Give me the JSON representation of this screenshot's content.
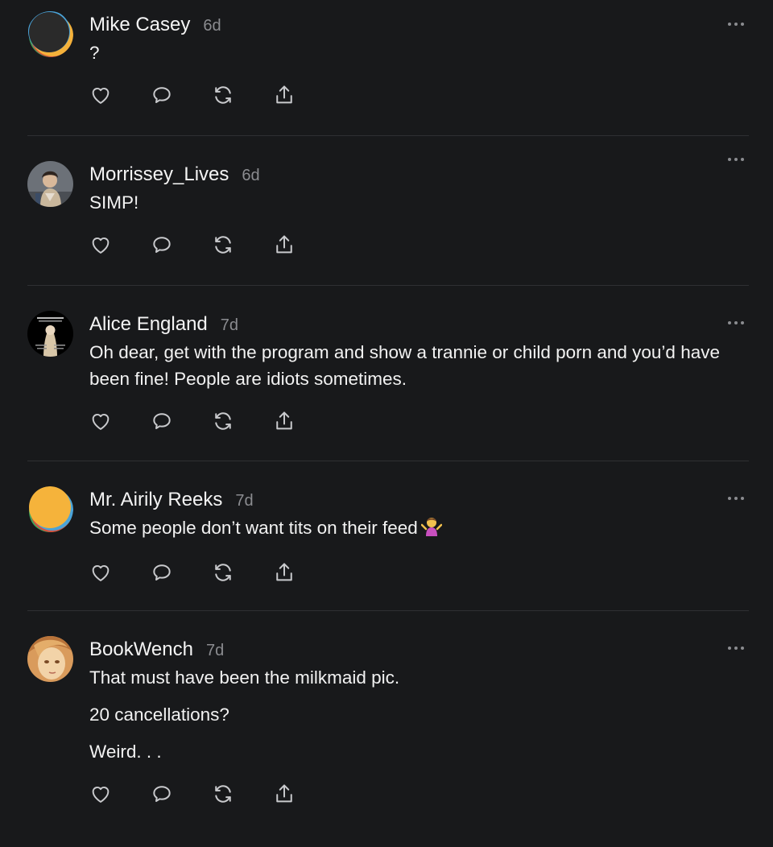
{
  "posts": [
    {
      "author": "Mike Casey",
      "time": "6d",
      "lines": [
        "?"
      ],
      "avatar": {
        "type": "default",
        "colors": [
          "#2b2b2b",
          "#4aa3d8",
          "#f4b13a",
          "#d94f3d",
          "#3fa55b"
        ]
      }
    },
    {
      "author": "Morrissey_Lives",
      "time": "6d",
      "lines": [
        "SIMP!"
      ],
      "avatar": {
        "type": "photo",
        "colors": [
          "#5a5f66",
          "#c9b79c",
          "#3b2f2a"
        ]
      }
    },
    {
      "author": "Alice England",
      "time": "7d",
      "lines": [
        "Oh dear, get with the program and show a trannie or child porn and you’d have been fine! People are idiots sometimes."
      ],
      "avatar": {
        "type": "photo",
        "colors": [
          "#000000",
          "#d8c6a8",
          "#8a7a6a"
        ]
      }
    },
    {
      "author": "Mr. Airily Reeks",
      "time": "7d",
      "lines": [
        "Some people don’t want tits on their feed"
      ],
      "emoji": "person-shrugging",
      "avatar": {
        "type": "default",
        "colors": [
          "#f5b33b",
          "#d94f3d",
          "#3fa55b",
          "#4aa3d8"
        ]
      }
    },
    {
      "author": "BookWench",
      "time": "7d",
      "lines": [
        "That must have been the milkmaid pic.",
        "20 cancellations?",
        "Weird. . ."
      ],
      "avatar": {
        "type": "photo",
        "colors": [
          "#d99b5c",
          "#f2d3a8",
          "#7a4a25"
        ]
      }
    }
  ],
  "actions": [
    {
      "name": "like",
      "icon": "heart-icon"
    },
    {
      "name": "comment",
      "icon": "speech-bubble-icon"
    },
    {
      "name": "restack",
      "icon": "refresh-icon"
    },
    {
      "name": "share",
      "icon": "share-upload-icon"
    }
  ],
  "colors": {
    "background": "#18191b",
    "text": "#f2f2f2",
    "muted": "#8b8c90",
    "divider": "#2f3033"
  }
}
